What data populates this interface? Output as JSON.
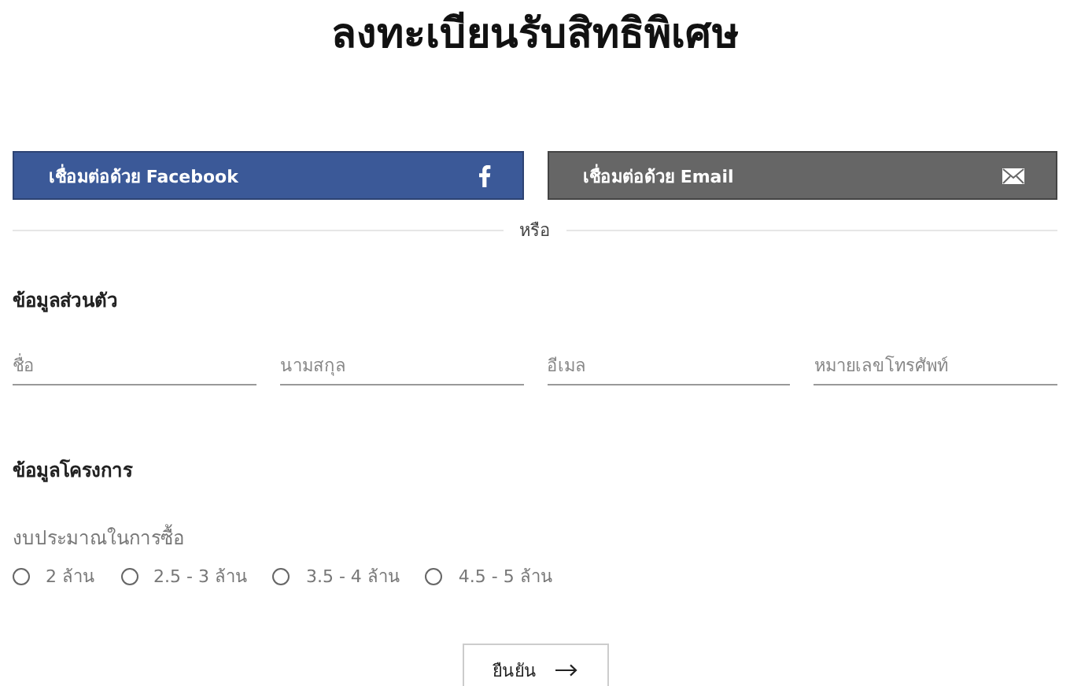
{
  "title": "ลงทะเบียนรับสิทธิพิเศษ",
  "connect_buttons": [
    {
      "kind": "facebook",
      "label": "เชื่อมต่อด้วย Facebook"
    },
    {
      "kind": "email",
      "label": "เชื่อมต่อด้วย Email"
    }
  ],
  "divider_text": "หรือ",
  "personal_section": {
    "heading": "ข้อมูลส่วนตัว",
    "fields": [
      {
        "placeholder": "ชื่อ"
      },
      {
        "placeholder": "นามสกุล"
      },
      {
        "placeholder": "อีเมล"
      },
      {
        "placeholder": "หมายเลขโทรศัพท์"
      }
    ]
  },
  "project_section": {
    "heading": "ข้อมูลโครงการ",
    "budget_label": "งบประมาณในการซื้อ",
    "budget_options": [
      {
        "label": "2 ล้าน",
        "selected": false
      },
      {
        "label": "2.5 - 3 ล้าน",
        "selected": false
      },
      {
        "label": "3.5 - 4 ล้าน",
        "selected": false
      },
      {
        "label": "4.5 - 5 ล้าน",
        "selected": false
      }
    ]
  },
  "submit_button": {
    "label": "ยืนยัน"
  }
}
